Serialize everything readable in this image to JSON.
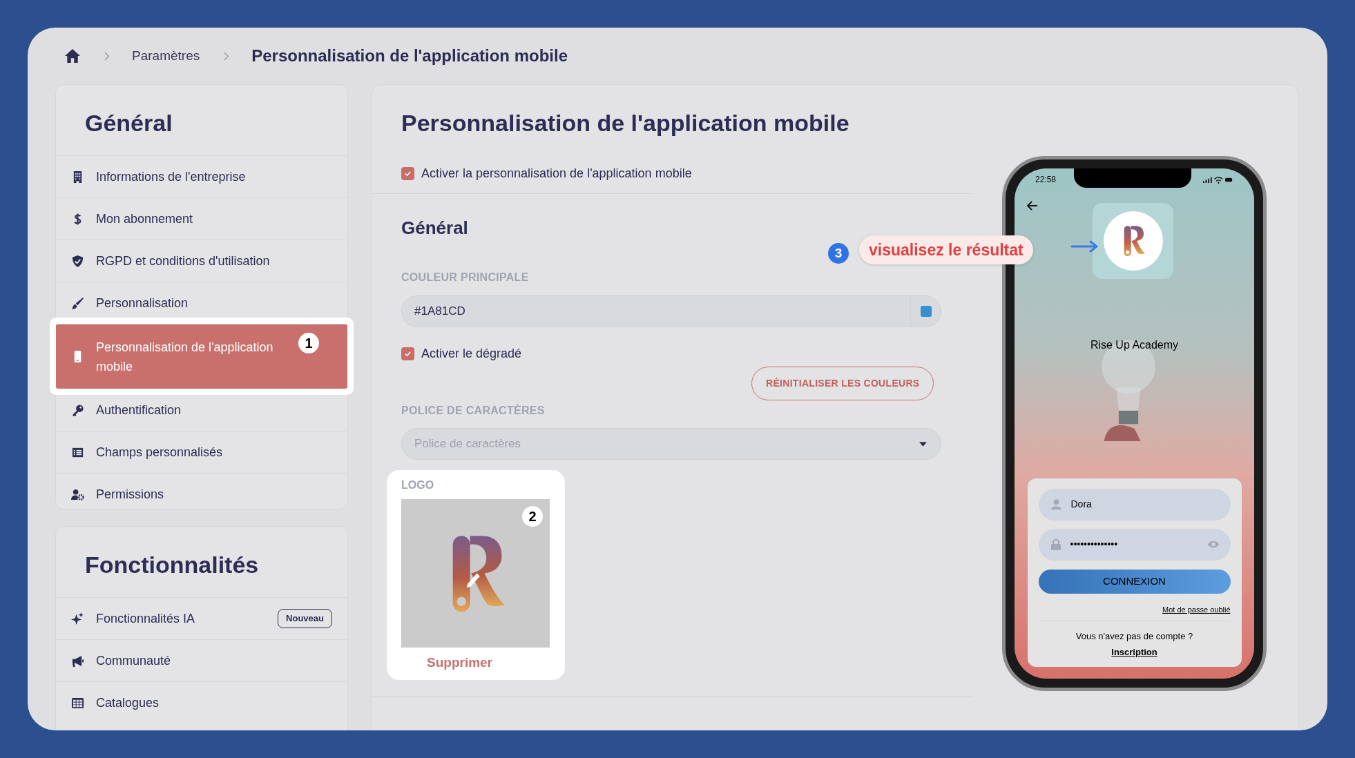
{
  "breadcrumb": {
    "items": [
      "Paramètres"
    ],
    "current": "Personnalisation de l'application mobile"
  },
  "sidebar": [
    {
      "title": "Général",
      "items": [
        {
          "label": "Informations de l'entreprise",
          "selected": false
        },
        {
          "label": "Mon abonnement",
          "selected": false
        },
        {
          "label": "RGPD et conditions d'utilisation",
          "selected": false
        },
        {
          "label": "Personnalisation",
          "selected": false
        },
        {
          "label": "Personnalisation de l'application mobile",
          "selected": true,
          "marker": "1"
        },
        {
          "label": "Authentification",
          "selected": false
        },
        {
          "label": "Champs personnalisés",
          "selected": false
        },
        {
          "label": "Permissions",
          "selected": false
        }
      ]
    },
    {
      "title": "Fonctionnalités",
      "items": [
        {
          "label": "Fonctionnalités IA",
          "selected": false,
          "badge": "Nouveau"
        },
        {
          "label": "Communauté",
          "selected": false
        },
        {
          "label": "Catalogues",
          "selected": false
        }
      ]
    }
  ],
  "main": {
    "title": "Personnalisation de l'application mobile",
    "enable": {
      "label": "Activer la personnalisation de l'application mobile",
      "checked": true
    },
    "section_title": "Général",
    "main_color": {
      "label": "COULEUR PRINCIPALE",
      "value": "#1A81CD"
    },
    "gradient": {
      "label": "Activer le dégradé",
      "checked": true
    },
    "reset_button": "RÉINITIALISER LES COULEURS",
    "font": {
      "label": "POLICE DE CARACTÈRES",
      "placeholder": "Police de caractères"
    },
    "logo": {
      "label": "LOGO",
      "marker": "2",
      "delete": "Supprimer"
    },
    "callout": {
      "marker": "3",
      "text": "visualisez le résultat"
    }
  },
  "phone": {
    "time": "22:58",
    "app_name": "Rise Up Academy",
    "username": "Dora",
    "password": "••••••••••••••",
    "login_button": "CONNEXION",
    "forgot": "Mot de passe oublié",
    "no_account": "Vous n'avez pas de compte ?",
    "signup": "Inscription"
  }
}
